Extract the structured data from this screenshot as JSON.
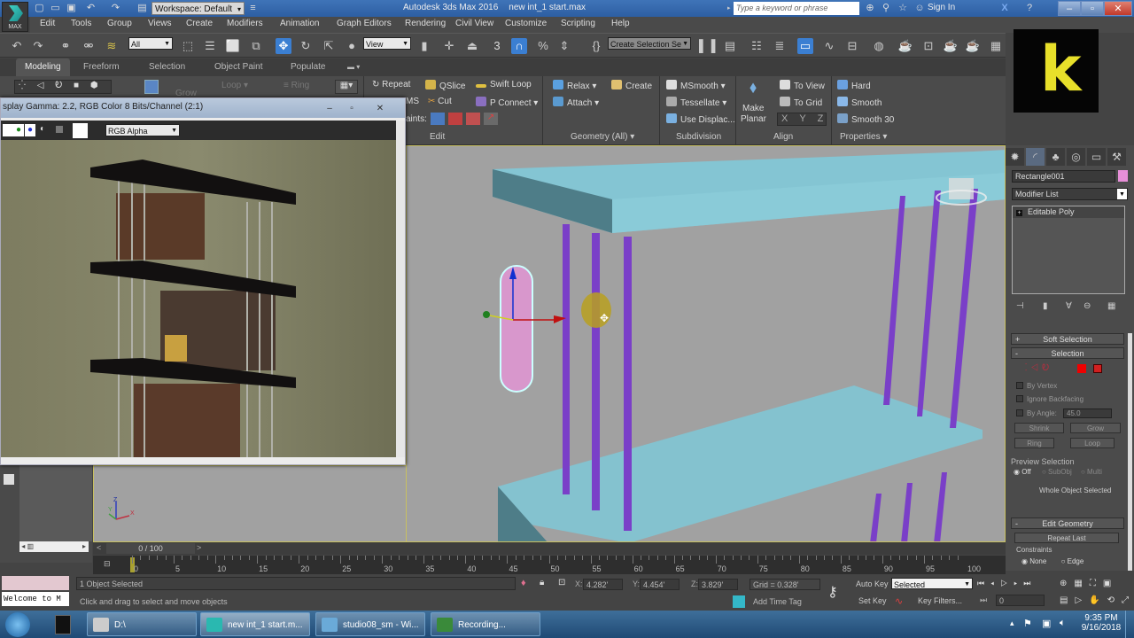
{
  "titlebar": {
    "app_name": "Autodesk 3ds Max 2016",
    "file_name": "new int_1 start.max",
    "workspace": "Workspace: Default",
    "search_placeholder": "Type a keyword or phrase",
    "sign_in": "Sign In",
    "logo_label": "MAX"
  },
  "menu": [
    "Edit",
    "Tools",
    "Group",
    "Views",
    "Create",
    "Modifiers",
    "Animation",
    "Graph Editors",
    "Rendering",
    "Civil View",
    "Customize",
    "Scripting",
    "Help"
  ],
  "main_toolbar": {
    "selection_filter": "All",
    "ref_coord": "View",
    "snap_number": "3",
    "named_selection_placeholder": "Create Selection Se"
  },
  "ribbon_tabs": [
    "Modeling",
    "Freeform",
    "Selection",
    "Object Paint",
    "Populate"
  ],
  "ribbon": {
    "dimmed": {
      "grow": "Grow",
      "loop": "Loop",
      "ring": "Ring"
    },
    "edit": {
      "repeat": "Repeat",
      "qslice": "QSlice",
      "swift_loop": "Swift Loop",
      "msm": "MS",
      "cut": "Cut",
      "p_connect": "P Connect",
      "constraints": "aints:",
      "label": "Edit"
    },
    "geometry": {
      "relax": "Relax",
      "create": "Create",
      "attach": "Attach",
      "label": "Geometry (All)"
    },
    "subdivision": {
      "msmooth": "MSmooth",
      "tessellate": "Tessellate",
      "use_displace": "Use Displac...",
      "label": "Subdivision"
    },
    "align": {
      "make_planar_1": "Make",
      "make_planar_2": "Planar",
      "to_view": "To View",
      "to_grid": "To Grid",
      "x": "X",
      "y": "Y",
      "z": "Z",
      "label": "Align"
    },
    "properties": {
      "hard": "Hard",
      "smooth": "Smooth",
      "smooth30": "Smooth 30",
      "label": "Properties"
    }
  },
  "frame_buffer": {
    "title": "splay Gamma: 2.2, RGB Color 8 Bits/Channel (2:1)",
    "channel": "RGB Alpha"
  },
  "viewport": {
    "axis_labels": {
      "x": "X",
      "y": "Y",
      "z": "Z"
    }
  },
  "command_panel": {
    "object_name": "Rectangle001",
    "object_color": "#e78fd8",
    "modifier_list": "Modifier List",
    "stack": [
      "Editable Poly"
    ],
    "soft_selection": "Soft Selection",
    "selection": "Selection",
    "by_vertex": "By Vertex",
    "ignore_backfacing": "Ignore Backfacing",
    "by_angle": "By Angle:",
    "angle_value": "45.0",
    "shrink": "Shrink",
    "grow": "Grow",
    "ring": "Ring",
    "loop": "Loop",
    "preview_selection": "Preview Selection",
    "preview_options": [
      "Off",
      "SubObj",
      "Multi"
    ],
    "preview_selected": "Off",
    "whole_object": "Whole Object Selected",
    "edit_geometry": "Edit Geometry",
    "repeat_last": "Repeat Last",
    "constraints": "Constraints",
    "constraint_options": [
      "None",
      "Edge"
    ],
    "constraint_selected": "None"
  },
  "timeline": {
    "frame_display": "0 / 100",
    "current_frame": 0,
    "total_frames": 100,
    "ticks": [
      "0",
      "5",
      "10",
      "15",
      "20",
      "25",
      "30",
      "35",
      "40",
      "45",
      "50",
      "55",
      "60",
      "65",
      "70",
      "75",
      "80",
      "85",
      "90",
      "95",
      "100"
    ]
  },
  "status": {
    "selected": "1 Object Selected",
    "prompt": "Click and drag to select and move objects",
    "listener": "Welcome to M",
    "x_label": "X:",
    "x": "4.282'",
    "y_label": "Y:",
    "y": "4.454'",
    "z_label": "Z:",
    "z": "3.829'",
    "grid": "Grid = 0.328'",
    "add_time_tag": "Add Time Tag",
    "auto_key": "Auto Key",
    "set_key": "Set Key",
    "key_mode": "Selected",
    "key_filters": "Key Filters...",
    "frame_field": "0"
  },
  "taskbar": {
    "items": [
      "D:\\",
      "new int_1 start.m...",
      "studio08_sm - Wi...",
      "Recording..."
    ],
    "time": "9:35 PM",
    "date": "9/16/2018"
  }
}
